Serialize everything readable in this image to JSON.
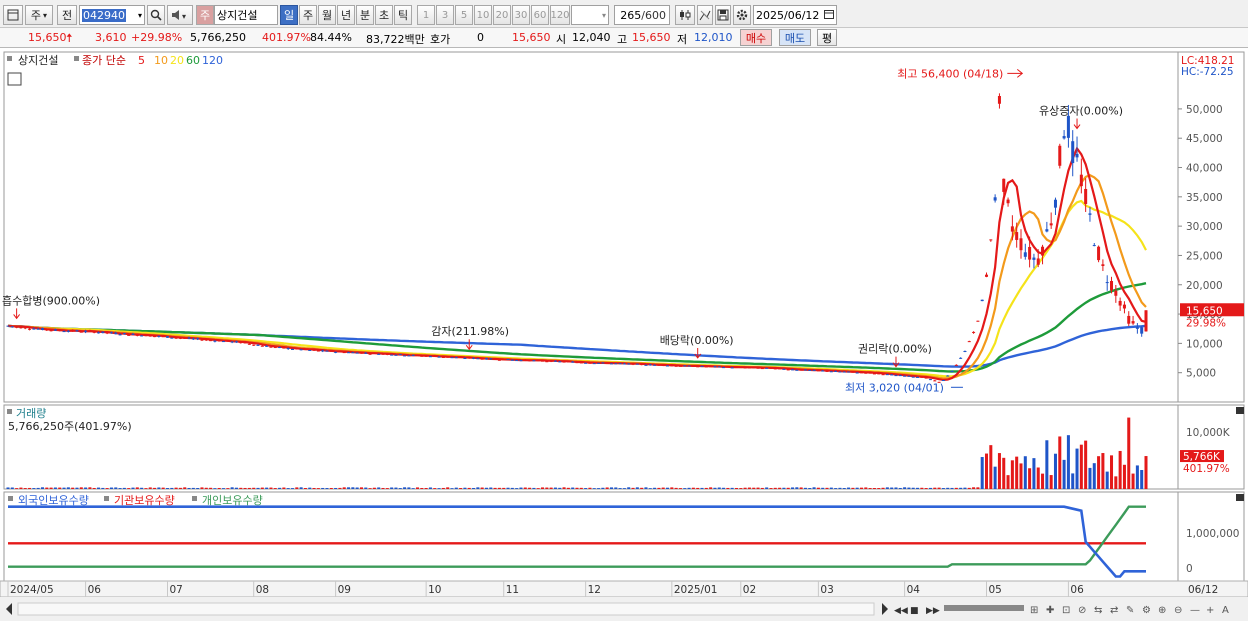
{
  "toolbar": {
    "period_select": "주",
    "prev_label": "전",
    "code": "042940",
    "name_tag": "주",
    "name": "상지건설",
    "period_tabs": [
      "일",
      "주",
      "월",
      "년",
      "분",
      "초",
      "틱"
    ],
    "interval_tabs": [
      "1",
      "3",
      "5",
      "10",
      "20",
      "30",
      "60",
      "120"
    ],
    "count": "265",
    "count_total": "/600",
    "date": "2025/06/12"
  },
  "quote": {
    "price": "15,650",
    "change": "3,610",
    "change_pct": "+29.98%",
    "volume": "5,766,250",
    "volume_pct": "401.97%",
    "ratio": "84.44%",
    "amount": "83,722백만",
    "hoga_label": "호가",
    "hoga_value": "0",
    "hoga_price": "15,650",
    "open_label": "시",
    "open": "12,040",
    "high_label": "고",
    "high": "15,650",
    "low_label": "저",
    "low": "12,010",
    "buy_label": "매수",
    "sell_label": "매도",
    "eval_label": "평"
  },
  "legend": {
    "stock": "상지건설",
    "ma_title": "종가 단순",
    "ma_periods": [
      "5",
      "10",
      "20",
      "60",
      "120"
    ]
  },
  "colors": {
    "up": "#e41919",
    "down": "#1f55c8",
    "ma5": "#e41919",
    "ma10": "#f39a1b",
    "ma20": "#f5e31a",
    "ma60": "#1e9b3a",
    "ma120": "#2f63d8",
    "foreign": "#2f63d8",
    "institution": "#e41919",
    "individual": "#3c9b5a"
  },
  "chart_data": [
    {
      "type": "candlestick",
      "title": "상지건설",
      "x_dates": [
        "2024/05",
        "06",
        "07",
        "08",
        "09",
        "10",
        "11",
        "12",
        "2025/01",
        "02",
        "03",
        "04",
        "05",
        "06"
      ],
      "ylim": [
        0,
        58000
      ],
      "y_ticks": [
        "5,000",
        "10,000",
        "15,000",
        "20,000",
        "25,000",
        "30,000",
        "35,000",
        "40,000",
        "45,000",
        "50,000"
      ],
      "y_tick_values": [
        5000,
        10000,
        15000,
        20000,
        25000,
        30000,
        35000,
        40000,
        45000,
        50000
      ],
      "lc": "LC:418.21",
      "hc": "HC:-72.25",
      "last_price_label": "15,650",
      "last_pct_label": "29.98%",
      "high_note": "최고 56,400 (04/18)",
      "low_note": "최저 3,020 (04/01)",
      "events": [
        {
          "label": "흡수합병(900.00%)",
          "index": 2
        },
        {
          "label": "감자(211.98%)",
          "index": 107
        },
        {
          "label": "배당락(0.00%)",
          "index": 160
        },
        {
          "label": "권리락(0.00%)",
          "index": 206
        },
        {
          "label": "유상증자(0.00%)",
          "index": 248
        }
      ]
    },
    {
      "type": "bar",
      "title": "거래량",
      "volume_note": "5,766,250주(401.97%)",
      "y_ticks": [
        "10,000K"
      ],
      "y_tick_values": [
        10000000
      ],
      "last_label": "5,766K",
      "last_pct": "401.97%"
    },
    {
      "type": "line",
      "series": [
        {
          "name": "외국인보유수량"
        },
        {
          "name": "기관보유수량"
        },
        {
          "name": "개인보유수량"
        }
      ],
      "y_ticks": [
        "1,000,000",
        "0"
      ],
      "y_tick_values": [
        1000000,
        0
      ]
    }
  ],
  "bottom": {
    "date_labels": [
      "2024/05",
      "06",
      "07",
      "08",
      "09",
      "10",
      "11",
      "12",
      "2025/01",
      "02",
      "03",
      "04",
      "05",
      "06",
      "06/12"
    ]
  }
}
